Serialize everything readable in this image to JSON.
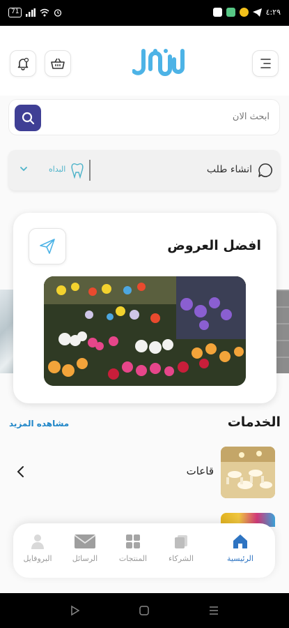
{
  "status_bar": {
    "battery": "71",
    "time": "٤:٢٩"
  },
  "search": {
    "placeholder": "ابحث الان"
  },
  "request": {
    "label": "انشاء طلب",
    "start_label": "البداه"
  },
  "offers": {
    "title": "افضل العروض"
  },
  "services": {
    "title": "الخدمات",
    "see_more": "مشاهده المزيد",
    "items": [
      {
        "label": "قاعات"
      }
    ]
  },
  "bottom_nav": {
    "items": [
      {
        "label": "الرئيسية",
        "icon": "home-icon",
        "active": true
      },
      {
        "label": "الشركاء",
        "icon": "partners-icon",
        "active": false
      },
      {
        "label": "المنتجات",
        "icon": "products-grid-icon",
        "active": false
      },
      {
        "label": "الرسائل",
        "icon": "mail-icon",
        "active": false
      },
      {
        "label": "البروفايل",
        "icon": "profile-icon",
        "active": false
      }
    ]
  },
  "colors": {
    "brand": "#4db3e6",
    "search_button": "#3f3f95",
    "active_nav": "#2e74c2",
    "link": "#1f86c8"
  }
}
